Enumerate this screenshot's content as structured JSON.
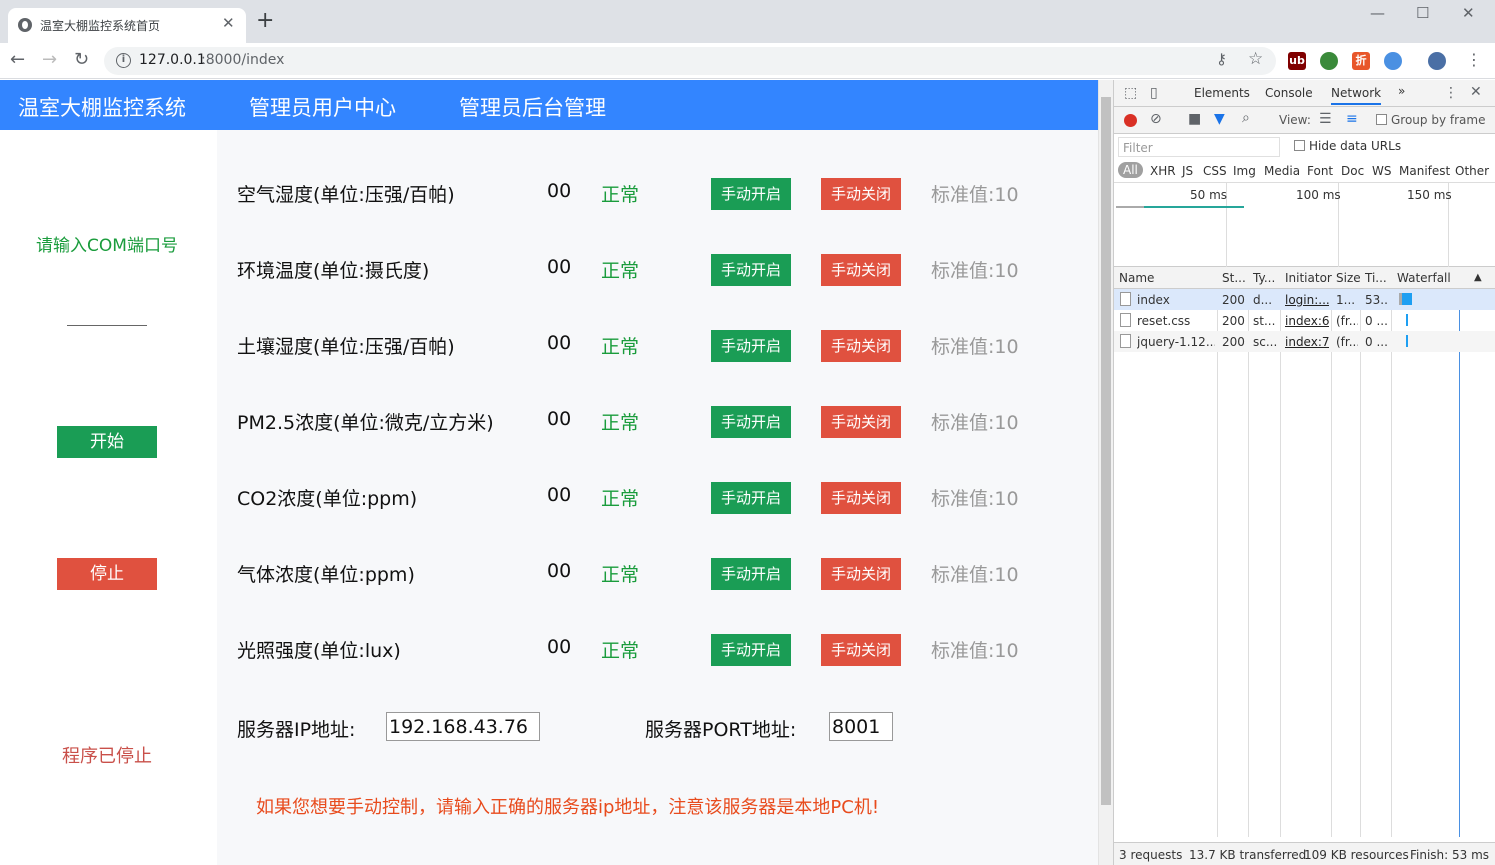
{
  "browser": {
    "tab_title": "温室大棚监控系统首页",
    "tab_close": "✕",
    "new_tab": "+",
    "url_host": "127.0.0.1",
    "url_path": ":8000/index",
    "info_glyph": "i",
    "back": "←",
    "forward": "→",
    "reload": "↻",
    "minimize": "—",
    "maximize": "☐",
    "close": "✕",
    "key": "⚷",
    "star": "☆",
    "menu": "⋮",
    "ext_labels": [
      "ub",
      "",
      "折",
      "",
      ""
    ]
  },
  "nav": {
    "brand": "温室大棚监控系统",
    "user_center": "管理员用户中心",
    "admin": "管理员后台管理"
  },
  "left": {
    "com_label": "请输入COM端口号",
    "com_value": "",
    "start": "开始",
    "stop": "停止",
    "status": "程序已停止"
  },
  "sensors": [
    {
      "label": "空气湿度(单位:压强/百帕)",
      "value": "00",
      "status": "正常",
      "on": "手动开启",
      "off": "手动关闭",
      "std": "标准值:10"
    },
    {
      "label": "环境温度(单位:摄氏度)",
      "value": "00",
      "status": "正常",
      "on": "手动开启",
      "off": "手动关闭",
      "std": "标准值:10"
    },
    {
      "label": "土壤湿度(单位:压强/百帕)",
      "value": "00",
      "status": "正常",
      "on": "手动开启",
      "off": "手动关闭",
      "std": "标准值:10"
    },
    {
      "label": "PM2.5浓度(单位:微克/立方米)",
      "value": "00",
      "status": "正常",
      "on": "手动开启",
      "off": "手动关闭",
      "std": "标准值:10"
    },
    {
      "label": "CO2浓度(单位:ppm)",
      "value": "00",
      "status": "正常",
      "on": "手动开启",
      "off": "手动关闭",
      "std": "标准值:10"
    },
    {
      "label": "气体浓度(单位:ppm)",
      "value": "00",
      "status": "正常",
      "on": "手动开启",
      "off": "手动关闭",
      "std": "标准值:10"
    },
    {
      "label": "光照强度(单位:lux)",
      "value": "00",
      "status": "正常",
      "on": "手动开启",
      "off": "手动关闭",
      "std": "标准值:10"
    }
  ],
  "server": {
    "ip_label": "服务器IP地址:",
    "ip_value": "192.168.43.76",
    "port_label": "服务器PORT地址:",
    "port_value": "8001",
    "hint": "如果您想要手动控制，请输入正确的服务器ip地址，注意该服务器是本地PC机!"
  },
  "devtools": {
    "tabs": [
      "Elements",
      "Console",
      "Network",
      "»"
    ],
    "view_label": "View:",
    "group_by_frame": "Group by frame",
    "filter_placeholder": "Filter",
    "hide_data_urls": "Hide data URLs",
    "types": [
      "All",
      "XHR",
      "JS",
      "CSS",
      "Img",
      "Media",
      "Font",
      "Doc",
      "WS",
      "Manifest",
      "Other"
    ],
    "ticks": [
      "50 ms",
      "100 ms",
      "150 ms"
    ],
    "columns": [
      "Name",
      "St...",
      "Ty...",
      "Initiator",
      "Size",
      "Ti...",
      "Waterfall"
    ],
    "requests": [
      {
        "name": "index",
        "status": "200",
        "type": "d...",
        "initiator": "login:...",
        "size": "1...",
        "time": "53..."
      },
      {
        "name": "reset.css",
        "status": "200",
        "type": "st...",
        "initiator": "index:6",
        "size": "(fr...",
        "time": "0 ..."
      },
      {
        "name": "jquery-1.12....",
        "status": "200",
        "type": "sc...",
        "initiator": "index:7",
        "size": "(fr...",
        "time": "0 ..."
      }
    ],
    "footer": {
      "requests": "3 requests",
      "transferred": "13.7 KB transferred",
      "resources": "109 KB resources",
      "finish": "Finish: 53 ms"
    }
  },
  "colors": {
    "navbar": "#3385ff",
    "green_button": "#1a9d55",
    "red_button": "#e0513f",
    "status_green": "#1a9c3c",
    "hint_orange": "#e84b1d"
  }
}
